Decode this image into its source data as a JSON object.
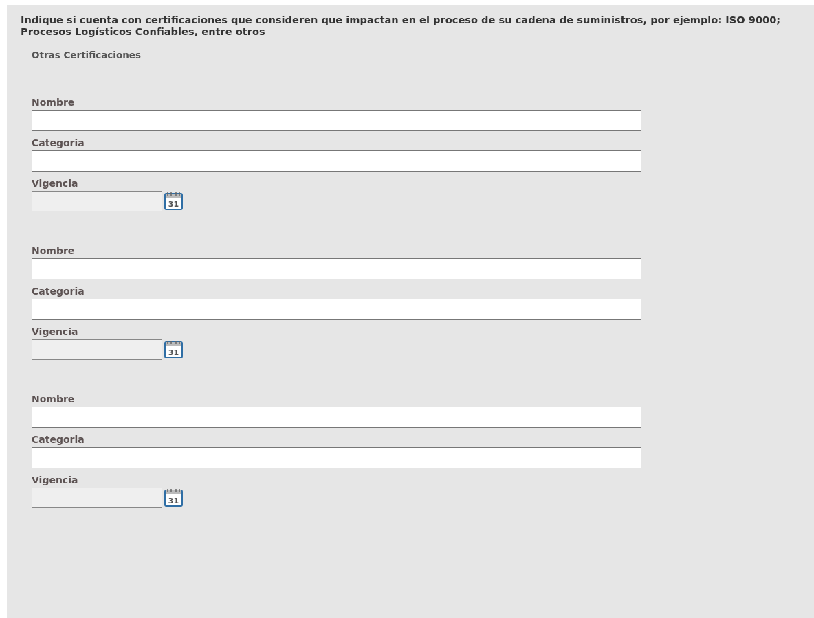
{
  "heading": "Indique si cuenta con certificaciones que consideren que impactan en el proceso de su cadena de suministros, por ejemplo: ISO 9000; Procesos Logísticos Confiables, entre otros",
  "section_title": "Otras Certificaciones",
  "groups": [
    {
      "fields": [
        {
          "kind": "text",
          "label": "Nombre"
        },
        {
          "kind": "text",
          "label": "Categoria"
        },
        {
          "kind": "date",
          "label": "Vigencia",
          "calendar_day": "31"
        }
      ]
    },
    {
      "fields": [
        {
          "kind": "text",
          "label": "Nombre"
        },
        {
          "kind": "text",
          "label": "Categoria"
        },
        {
          "kind": "date",
          "label": "Vigencia",
          "calendar_day": "31"
        }
      ]
    },
    {
      "fields": [
        {
          "kind": "text",
          "label": "Nombre"
        },
        {
          "kind": "text",
          "label": "Categoria"
        },
        {
          "kind": "date",
          "label": "Vigencia",
          "calendar_day": "31"
        }
      ]
    }
  ]
}
